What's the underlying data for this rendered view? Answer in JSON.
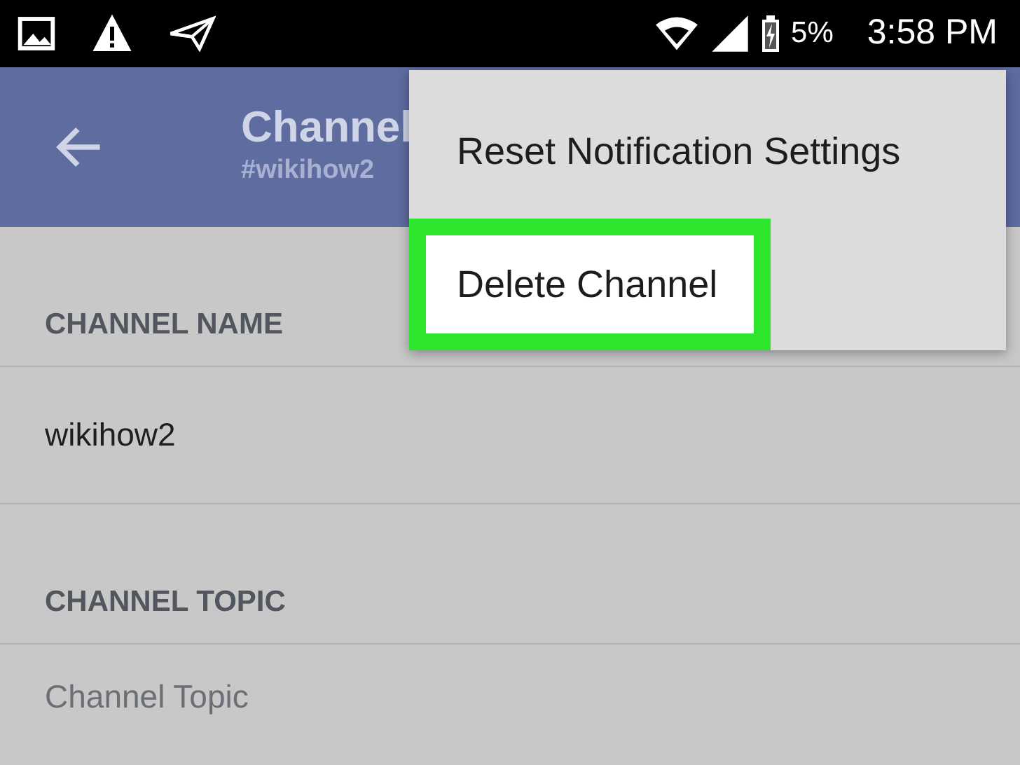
{
  "status_bar": {
    "battery": "5%",
    "time": "3:58 PM"
  },
  "app_bar": {
    "title": "Channel",
    "subtitle": "#wikihow2"
  },
  "sections": [
    {
      "kind": "value",
      "header": "CHANNEL NAME",
      "value": "wikihow2"
    },
    {
      "kind": "field",
      "header": "CHANNEL TOPIC",
      "placeholder": "Channel Topic"
    }
  ],
  "menu": {
    "items": [
      {
        "label": "Reset Notification Settings",
        "highlighted": false
      },
      {
        "label": "Delete Channel",
        "highlighted": true
      }
    ]
  }
}
